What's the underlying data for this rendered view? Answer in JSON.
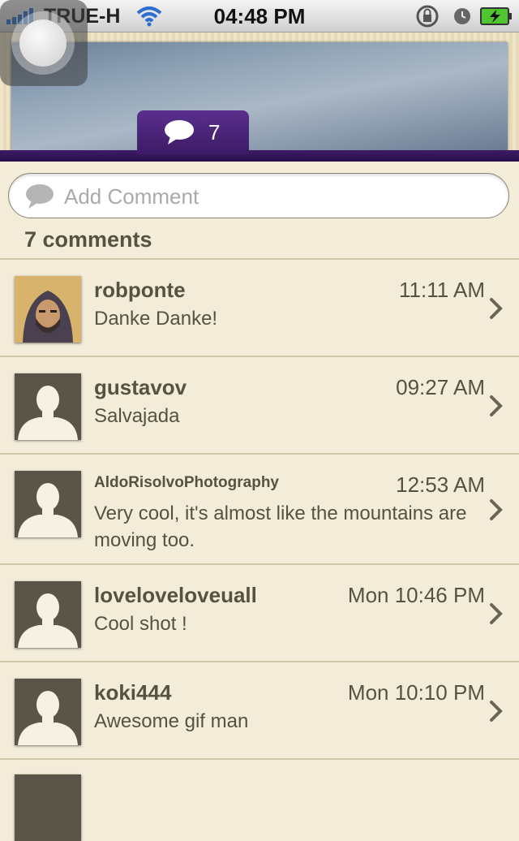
{
  "status_bar": {
    "carrier": "TRUE-H",
    "time": "04:48 PM",
    "icons": [
      "signal-icon",
      "wifi-icon",
      "rotation-lock-icon",
      "alarm-icon",
      "battery-charging-icon"
    ]
  },
  "header": {
    "comment_count_badge": "7"
  },
  "add_comment": {
    "placeholder": "Add Comment"
  },
  "comments_label": "7 comments",
  "comments": [
    {
      "user": "robponte",
      "time": "11:11 AM",
      "text": "Danke Danke!",
      "avatar": "photo"
    },
    {
      "user": "gustavov",
      "time": "09:27 AM",
      "text": "Salvajada",
      "avatar": "default"
    },
    {
      "user": "AldoRisolvoPhotography",
      "time": "12:53 AM",
      "text": "Very cool, it's almost like the mountains are moving too.",
      "avatar": "default"
    },
    {
      "user": "loveloveloveuall",
      "time": "Mon 10:46 PM",
      "text": "Cool shot !",
      "avatar": "default"
    },
    {
      "user": "koki444",
      "time": "Mon 10:10 PM",
      "text": "Awesome gif man",
      "avatar": "default"
    }
  ],
  "colors": {
    "accent_purple": "#3d1b66",
    "background": "#f3ecd9",
    "text": "#575142"
  }
}
